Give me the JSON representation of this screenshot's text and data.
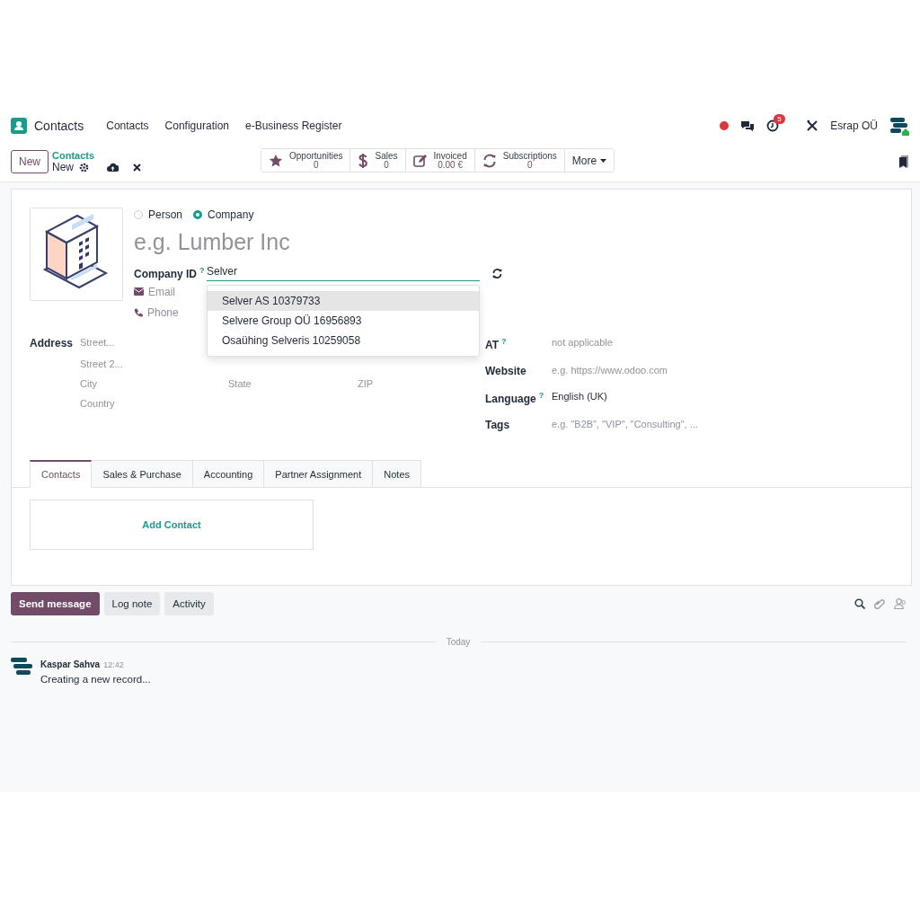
{
  "navbar": {
    "app_name": "Contacts",
    "menus": [
      "Contacts",
      "Configuration",
      "e-Business Register"
    ],
    "activity_count": "5",
    "company": "Esrap OÜ"
  },
  "control_panel": {
    "new_button": "New",
    "breadcrumb": "Contacts",
    "record": "New",
    "more_button": "More"
  },
  "smart_buttons": [
    {
      "kind": "star",
      "label": "Opportunities",
      "value": "0"
    },
    {
      "kind": "dollar",
      "label": "Sales",
      "value": "0"
    },
    {
      "kind": "edit",
      "label": "Invoiced",
      "value": "0.00 €"
    },
    {
      "kind": "refresh",
      "label": "Subscriptions",
      "value": "0"
    }
  ],
  "form": {
    "types": [
      {
        "label": "Person",
        "selected": false
      },
      {
        "label": "Company",
        "selected": true
      }
    ],
    "name_placeholder": "e.g. Lumber Inc",
    "company_id": {
      "label": "Company ID",
      "help": "?",
      "value": "Selver"
    },
    "suggestions": [
      {
        "label": "Selver AS 10379733",
        "selected": true
      },
      {
        "label": "Selvere Group OÜ 16956893",
        "selected": false
      },
      {
        "label": "Osaühing Selveris 10259058",
        "selected": false
      }
    ],
    "contact_fields": [
      {
        "kind": "email",
        "placeholder": "Email"
      },
      {
        "kind": "phone",
        "placeholder": "Phone"
      }
    ],
    "address": {
      "label": "Address",
      "street": "Street...",
      "street2": "Street 2...",
      "city": "City",
      "state": "State",
      "zip": "ZIP",
      "country": "Country"
    },
    "right_fields": [
      {
        "label": "AT",
        "help": "?",
        "placeholder": "not applicable"
      },
      {
        "label": "Website",
        "placeholder": "e.g. https://www.odoo.com"
      },
      {
        "label": "Language",
        "help": "?",
        "value": "English (UK)"
      },
      {
        "label": "Tags",
        "placeholder": "e.g. \"B2B\", \"VIP\", \"Consulting\", ..."
      }
    ]
  },
  "tabs": [
    {
      "label": "Contacts",
      "selected": true
    },
    {
      "label": "Sales & Purchase",
      "selected": false
    },
    {
      "label": "Accounting",
      "selected": false
    },
    {
      "label": "Partner Assignment",
      "selected": false
    },
    {
      "label": "Notes",
      "selected": false
    }
  ],
  "add_contact": "Add Contact",
  "chatter": {
    "buttons": [
      {
        "label": "Send message",
        "primary": true
      },
      {
        "label": "Log note",
        "primary": false
      },
      {
        "label": "Activity",
        "primary": false
      }
    ],
    "follower_count": "0",
    "divider": "Today",
    "messages": [
      {
        "author": "Kaspar Sahva",
        "time": "12:42",
        "body": "Creating a new record..."
      }
    ]
  }
}
